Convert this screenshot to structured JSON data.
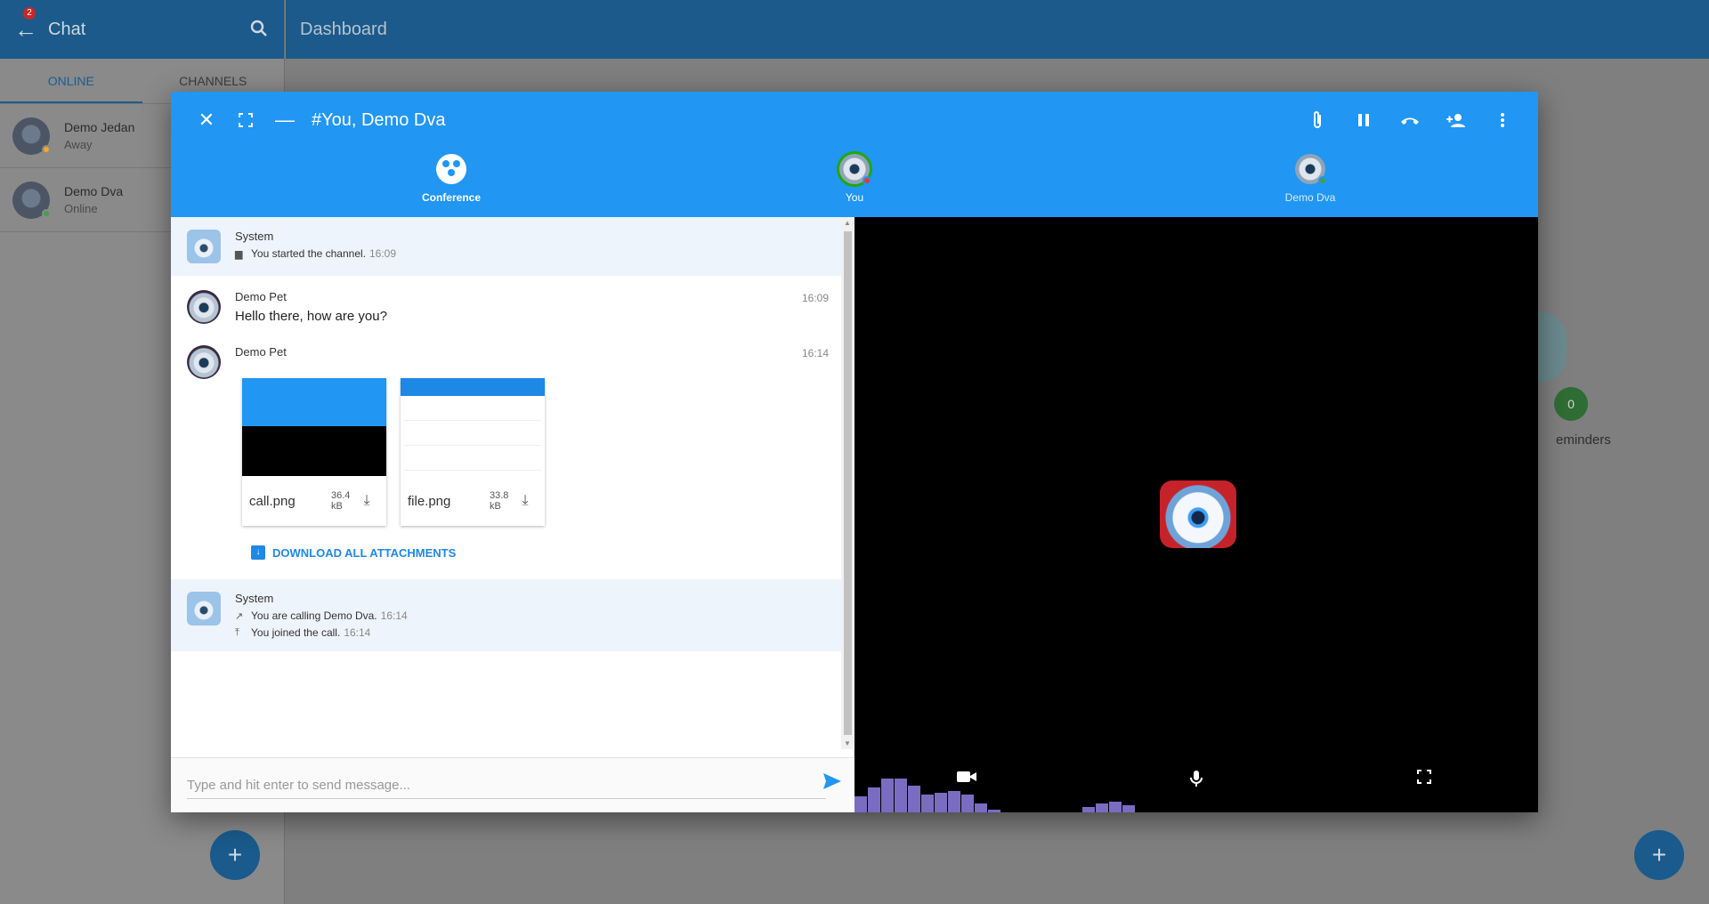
{
  "sidebar": {
    "badge": "2",
    "title": "Chat",
    "tabs": [
      "ONLINE",
      "CHANNELS"
    ],
    "contacts": [
      {
        "name": "Demo Jedan",
        "status": "Away",
        "status_color": "#f9a825"
      },
      {
        "name": "Demo Dva",
        "status": "Online",
        "status_color": "#43a047"
      }
    ],
    "fab": "+"
  },
  "topbar": {
    "title": "Dashboard"
  },
  "background": {
    "count": "0",
    "label": "eminders",
    "fab": "+"
  },
  "modal": {
    "title": "#You, Demo Dva",
    "participants": [
      {
        "label": "Conference"
      },
      {
        "label": "You",
        "status_color": "#e53935"
      },
      {
        "label": "Demo Dva",
        "status_color": "#43a047"
      }
    ],
    "messages": {
      "sys1": {
        "name": "System",
        "line": "You started the channel.",
        "time": "16:09"
      },
      "m1": {
        "name": "Demo Pet",
        "time": "16:09",
        "text": "Hello there, how are you?"
      },
      "m2": {
        "name": "Demo Pet",
        "time": "16:14"
      },
      "attachments": [
        {
          "name": "call.png",
          "size": "36.4 kB"
        },
        {
          "name": "file.png",
          "size": "33.8 kB"
        }
      ],
      "download_all": "DOWNLOAD ALL ATTACHMENTS",
      "sys2": {
        "name": "System",
        "lines": [
          {
            "text": "You are calling Demo Dva.",
            "time": "16:14"
          },
          {
            "text": "You joined the call.",
            "time": "16:14"
          }
        ]
      }
    },
    "composer": {
      "placeholder": "Type and hit enter to send message..."
    }
  },
  "colors": {
    "header": "#2196f3",
    "accent": "#1e88e5",
    "bg_header": "#1b5a8a"
  },
  "icons": [
    "back-arrow-icon",
    "search-icon",
    "close-icon",
    "fullscreen-icon",
    "minimize-icon",
    "attach-icon",
    "pause-icon",
    "hangup-icon",
    "add-person-icon",
    "more-icon",
    "send-icon",
    "camera-icon",
    "mic-icon",
    "expand-icon",
    "download-icon"
  ]
}
